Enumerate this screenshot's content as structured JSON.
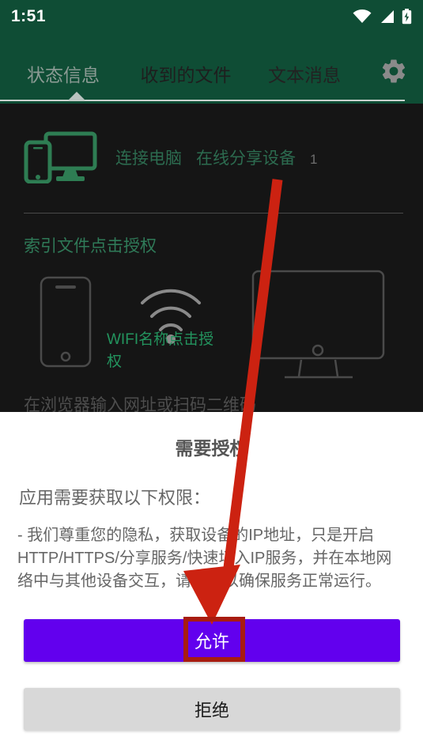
{
  "status_bar": {
    "time": "1:51",
    "icons": [
      "wifi-icon",
      "cellular-signal-icon",
      "battery-charging-icon"
    ]
  },
  "app_bar": {
    "tabs": [
      {
        "label": "状态信息",
        "selected": true
      },
      {
        "label": "收到的文件",
        "selected": false
      },
      {
        "label": "文本消息",
        "selected": false
      }
    ],
    "settings_icon": "gear-icon",
    "background_color": "#0F4D35"
  },
  "content": {
    "connect": {
      "icon": "phone-and-monitor-icon",
      "label": "连接电脑",
      "sub_label": "在线分享设备",
      "count": "1"
    },
    "index_label": "索引文件点击授权",
    "wifi_label": "WIFI名称点击授权",
    "browser_hint": "在浏览器输入网址或扫码二维码",
    "illustration_icons": [
      "phone-outline-icon",
      "wifi-waves-icon",
      "monitor-outline-icon"
    ],
    "accent_color": "#23945e",
    "background_color": "#151515"
  },
  "dialog": {
    "title": "需要授权",
    "subtitle": "应用需要获取以下权限：",
    "body": "- 我们尊重您的隐私，获取设备的IP地址，只是开启HTTP/HTTPS/分享服务/快速填入IP服务，并在本地网络中与其他设备交互，请授权以确保服务正常运行。",
    "allow_label": "允许",
    "deny_label": "拒绝",
    "allow_color": "#6200EE",
    "deny_color": "#d8d8d8"
  },
  "annotation": {
    "arrow_color": "#cc2211",
    "highlight_color": "#a81c10",
    "target": "allow-button"
  }
}
